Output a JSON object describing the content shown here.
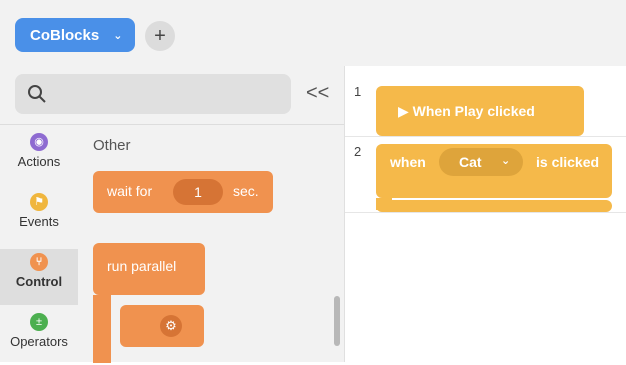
{
  "top": {
    "project_name": "CoBlocks",
    "add_label": "+"
  },
  "sidebar": {
    "collapse_label": "<<",
    "categories": [
      {
        "label": "Actions",
        "color": "#8e6bd1"
      },
      {
        "label": "Events",
        "color": "#f0b63e"
      },
      {
        "label": "Control",
        "color": "#f0924f"
      },
      {
        "label": "Operators",
        "color": "#4caf50"
      }
    ]
  },
  "palette": {
    "section_title": "Other",
    "wait_block": {
      "prefix": "wait for",
      "value": "1",
      "suffix": "sec."
    },
    "parallel_block": {
      "label": "run parallel"
    }
  },
  "workspace": {
    "line_numbers": [
      "1",
      "2"
    ],
    "play_block": {
      "label": "▶ When Play clicked"
    },
    "click_block": {
      "prefix": "when",
      "selected": "Cat",
      "suffix": "is clicked"
    }
  }
}
